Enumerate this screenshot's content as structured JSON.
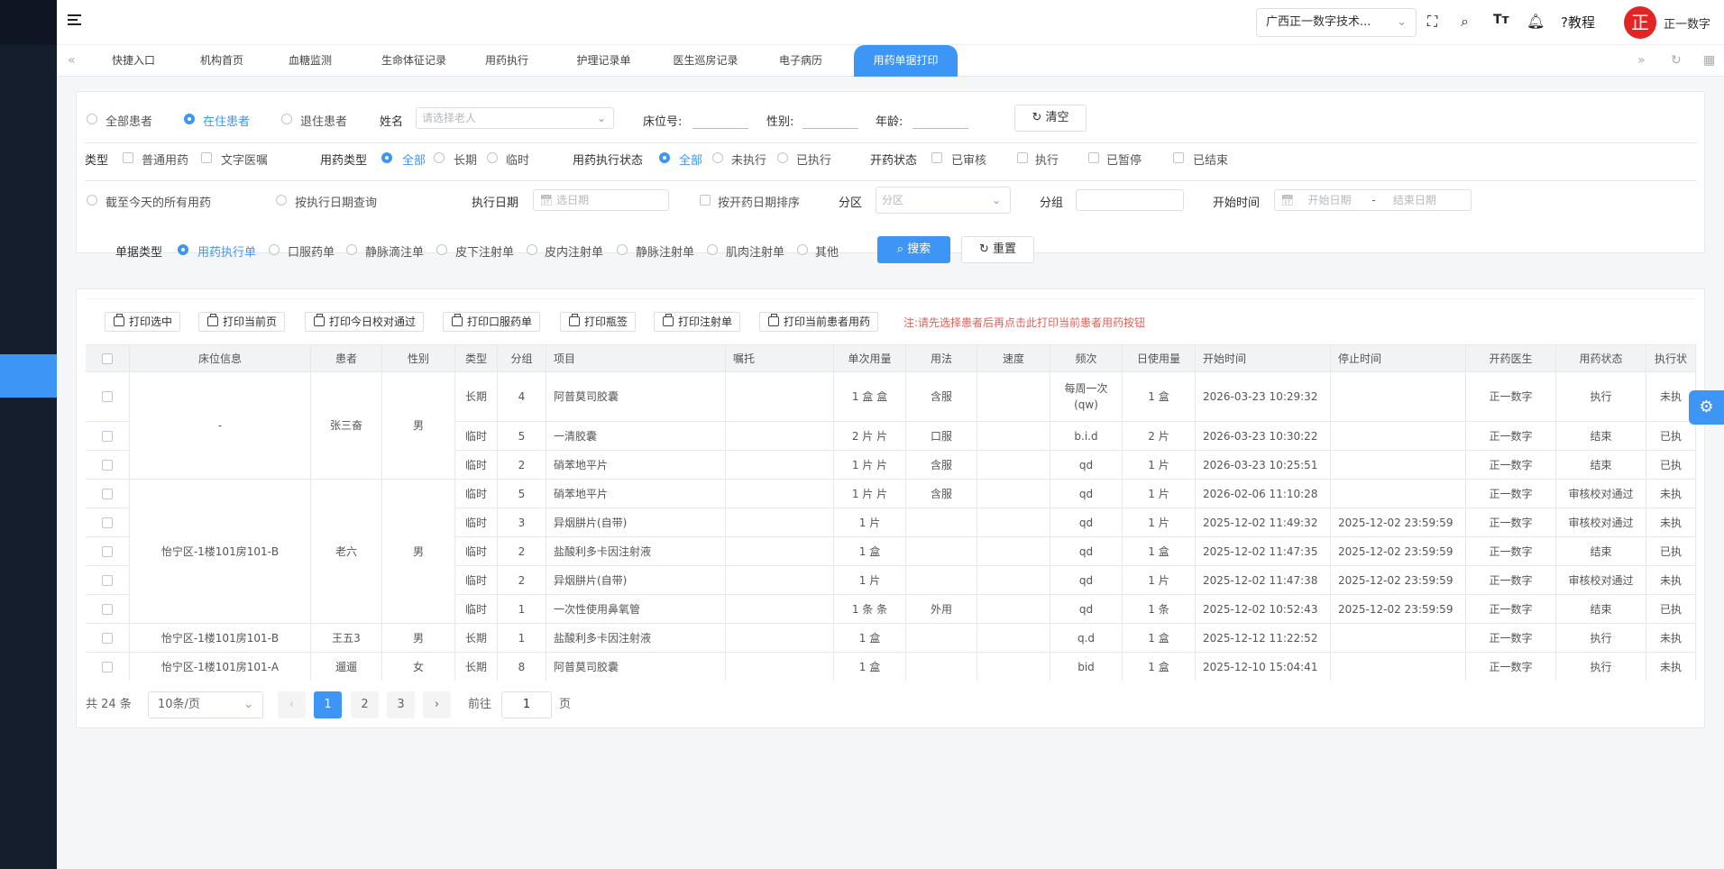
{
  "header": {
    "org_select": "广西正一数字技术...",
    "tutorial": "?教程",
    "avatar_char": "正",
    "username": "正一数字"
  },
  "tabs": [
    "快捷入口",
    "机构首页",
    "血糖监测",
    "生命体征记录",
    "用药执行",
    "护理记录单",
    "医生巡房记录",
    "电子病历",
    "用药单据打印"
  ],
  "active_tab": "用药单据打印",
  "filters": {
    "row1": {
      "patient_radios": [
        "全部患者",
        "在住患者",
        "退住患者"
      ],
      "name_label": "姓名",
      "name_placeholder": "请选择老人",
      "bed_label": "床位号:",
      "gender_label": "性别:",
      "age_label": "年龄:",
      "clear_btn": "清空"
    },
    "row2": {
      "type_label": "类型",
      "type_checks": [
        "普通用药",
        "文字医嘱"
      ],
      "drug_type_label": "用药类型",
      "drug_type_radios": [
        "全部",
        "长期",
        "临时"
      ],
      "exec_status_label": "用药执行状态",
      "exec_status_radios": [
        "全部",
        "未执行",
        "已执行"
      ],
      "open_status_label": "开药状态",
      "open_status_checks": [
        "已审核",
        "执行",
        "已暂停",
        "已结束"
      ]
    },
    "row3": {
      "range_radios": [
        "截至今天的所有用药",
        "按执行日期查询"
      ],
      "exec_date_label": "执行日期",
      "exec_date_placeholder": "选日期",
      "sort_check": "按开药日期排序",
      "area_label": "分区",
      "area_placeholder": "分区",
      "group_label": "分组",
      "start_time_label": "开始时间",
      "start_placeholder": "开始日期",
      "range_sep": "-",
      "end_placeholder": "结束日期"
    },
    "row4": {
      "doc_type_label": "单据类型",
      "doc_type_radios": [
        "用药执行单",
        "口服药单",
        "静脉滴注单",
        "皮下注射单",
        "皮内注射单",
        "静脉注射单",
        "肌肉注射单",
        "其他"
      ],
      "search_btn": "搜索",
      "reset_btn": "重置"
    }
  },
  "print_buttons": [
    "打印选中",
    "打印当前页",
    "打印今日校对通过",
    "打印口服药单",
    "打印瓶签",
    "打印注射单",
    "打印当前患者用药"
  ],
  "print_note": "注:请先选择患者后再点击此打印当前患者用药按钮",
  "table": {
    "columns": [
      "",
      "床位信息",
      "患者",
      "性别",
      "类型",
      "分组",
      "项目",
      "嘱托",
      "单次用量",
      "用法",
      "速度",
      "频次",
      "日使用量",
      "开始时间",
      "停止时间",
      "开药医生",
      "用药状态",
      "执行状"
    ],
    "groups": [
      {
        "bed": "-",
        "patient": "张三奋",
        "gender": "男",
        "rows": [
          {
            "type": "长期",
            "group": "4",
            "item": "阿普莫司胶囊",
            "note": "",
            "dose": "1 盒 盒",
            "usage": "含服",
            "speed": "",
            "freq": "每周一次(qw)",
            "daily": "1 盒",
            "start": "2026-03-23 10:29:32",
            "stop": "",
            "doctor": "正一数字",
            "status": "执行",
            "exec": "未执"
          },
          {
            "type": "临时",
            "group": "5",
            "item": "一清胶囊",
            "note": "",
            "dose": "2 片 片",
            "usage": "口服",
            "speed": "",
            "freq": "b.i.d",
            "daily": "2 片",
            "start": "2026-03-23 10:30:22",
            "stop": "",
            "doctor": "正一数字",
            "status": "结束",
            "exec": "已执"
          },
          {
            "type": "临时",
            "group": "2",
            "item": "硝苯地平片",
            "note": "",
            "dose": "1 片 片",
            "usage": "含服",
            "speed": "",
            "freq": "qd",
            "daily": "1 片",
            "start": "2026-03-23 10:25:51",
            "stop": "",
            "doctor": "正一数字",
            "status": "结束",
            "exec": "已执"
          }
        ]
      },
      {
        "bed": "怡宁区-1楼101房101-B",
        "patient": "老六",
        "gender": "男",
        "rows": [
          {
            "type": "临时",
            "group": "5",
            "item": "硝苯地平片",
            "note": "",
            "dose": "1 片 片",
            "usage": "含服",
            "speed": "",
            "freq": "qd",
            "daily": "1 片",
            "start": "2026-02-06 11:10:28",
            "stop": "",
            "doctor": "正一数字",
            "status": "审核校对通过",
            "exec": "未执"
          },
          {
            "type": "临时",
            "group": "3",
            "item": "异烟肼片(自带)",
            "note": "",
            "dose": "1 片",
            "usage": "",
            "speed": "",
            "freq": "qd",
            "daily": "1 片",
            "start": "2025-12-02 11:49:32",
            "stop": "2025-12-02 23:59:59",
            "doctor": "正一数字",
            "status": "审核校对通过",
            "exec": "未执"
          },
          {
            "type": "临时",
            "group": "2",
            "item": "盐酸利多卡因注射液",
            "note": "",
            "dose": "1 盒",
            "usage": "",
            "speed": "",
            "freq": "qd",
            "daily": "1 盒",
            "start": "2025-12-02 11:47:35",
            "stop": "2025-12-02 23:59:59",
            "doctor": "正一数字",
            "status": "结束",
            "exec": "已执"
          },
          {
            "type": "临时",
            "group": "2",
            "item": "异烟肼片(自带)",
            "note": "",
            "dose": "1 片",
            "usage": "",
            "speed": "",
            "freq": "qd",
            "daily": "1 片",
            "start": "2025-12-02 11:47:38",
            "stop": "2025-12-02 23:59:59",
            "doctor": "正一数字",
            "status": "审核校对通过",
            "exec": "未执"
          },
          {
            "type": "临时",
            "group": "1",
            "item": "一次性使用鼻氧管",
            "note": "",
            "dose": "1 条 条",
            "usage": "外用",
            "speed": "",
            "freq": "qd",
            "daily": "1 条",
            "start": "2025-12-02 10:52:43",
            "stop": "2025-12-02 23:59:59",
            "doctor": "正一数字",
            "status": "结束",
            "exec": "已执"
          }
        ]
      },
      {
        "bed": "怡宁区-1楼101房101-B",
        "patient": "王五3",
        "gender": "男",
        "rows": [
          {
            "type": "长期",
            "group": "1",
            "item": "盐酸利多卡因注射液",
            "note": "",
            "dose": "1 盒",
            "usage": "",
            "speed": "",
            "freq": "q.d",
            "daily": "1 盒",
            "start": "2025-12-12 11:22:52",
            "stop": "",
            "doctor": "正一数字",
            "status": "执行",
            "exec": "未执"
          }
        ]
      },
      {
        "bed": "怡宁区-1楼101房101-A",
        "patient": "遛遛",
        "gender": "女",
        "rows": [
          {
            "type": "长期",
            "group": "8",
            "item": "阿普莫司胶囊",
            "note": "",
            "dose": "1 盒",
            "usage": "",
            "speed": "",
            "freq": "bid",
            "daily": "1 盒",
            "start": "2025-12-10 15:04:41",
            "stop": "",
            "doctor": "正一数字",
            "status": "执行",
            "exec": "未执"
          }
        ]
      }
    ]
  },
  "pagination": {
    "total": "共 24 条",
    "page_size": "10条/页",
    "prev": "‹",
    "pages": [
      "1",
      "2",
      "3"
    ],
    "current": "1",
    "next": "›",
    "goto_label": "前往",
    "goto_value": "1",
    "goto_suffix": "页"
  },
  "colors": {
    "accent": "#3d95f5",
    "sidebar": "#151e2d",
    "note": "#e0625a"
  }
}
